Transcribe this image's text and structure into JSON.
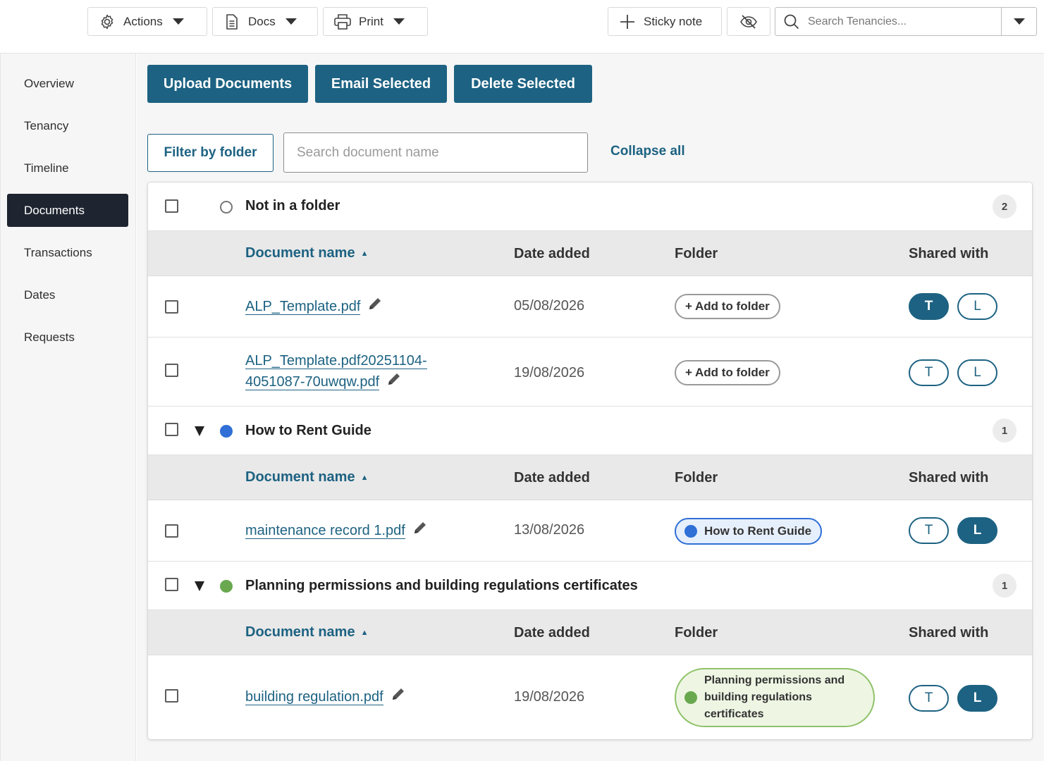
{
  "toolbar": {
    "actions_label": "Actions",
    "docs_label": "Docs",
    "print_label": "Print",
    "sticky_label": "Sticky note",
    "search_placeholder": "Search Tenancies..."
  },
  "sidebar": {
    "items": [
      {
        "label": "Overview"
      },
      {
        "label": "Tenancy"
      },
      {
        "label": "Timeline"
      },
      {
        "label": "Documents",
        "active": true
      },
      {
        "label": "Transactions"
      },
      {
        "label": "Dates"
      },
      {
        "label": "Requests"
      }
    ]
  },
  "main": {
    "upload_label": "Upload Documents",
    "email_label": "Email Selected",
    "delete_label": "Delete Selected",
    "filter_label": "Filter by folder",
    "search_placeholder": "Search document name",
    "collapse_label": "Collapse all",
    "columns": {
      "name": "Document name",
      "date": "Date added",
      "folder": "Folder",
      "shared": "Shared with"
    },
    "groups": [
      {
        "name": "Not in a folder",
        "count": "2",
        "docs": [
          {
            "name": "ALP_Template.pdf",
            "date": "05/08/2026",
            "add_folder": "+ Add to folder",
            "t": "T",
            "l": "L"
          },
          {
            "name_line1": "ALP_Template.pdf20251104-",
            "name_line2": "4051087-70uwqw.pdf",
            "date": "19/08/2026",
            "add_folder": "+ Add to folder",
            "t": "T",
            "l": "L"
          }
        ]
      },
      {
        "name": "How to Rent Guide",
        "count": "1",
        "docs": [
          {
            "name": "maintenance record 1.pdf",
            "date": "13/08/2026",
            "folder": "How to Rent Guide",
            "t": "T",
            "l": "L"
          }
        ]
      },
      {
        "name": "Planning permissions and building regulations certificates",
        "count": "1",
        "docs": [
          {
            "name": "building regulation.pdf",
            "date": "19/08/2026",
            "folder_line1": "Planning permissions and",
            "folder_line2": "building regulations",
            "folder_line3": "certificates",
            "t": "T",
            "l": "L"
          }
        ]
      }
    ]
  },
  "colors": {
    "primary": "#1d6282",
    "sidebar_active": "#1e2530",
    "folder_blue": "#2f6fd6",
    "folder_green": "#6aa84f",
    "pill_blue_bg": "#e6effc",
    "pill_green_bg": "#eef6e3"
  }
}
